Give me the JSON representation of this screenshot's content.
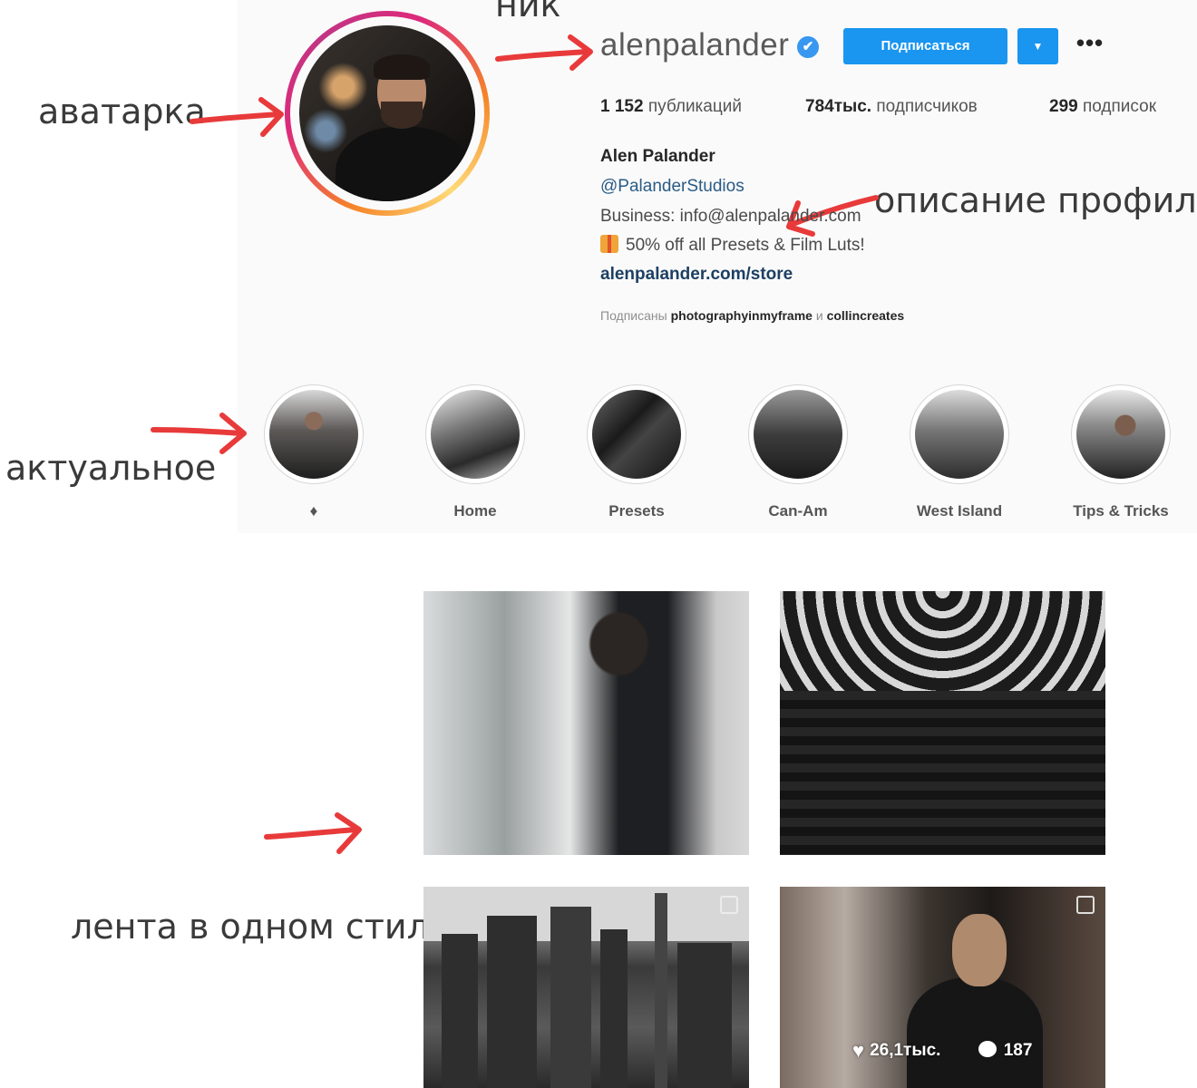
{
  "annotations": {
    "nick": "ник",
    "avatar": "аватарка",
    "description": "описание профиля",
    "highlights": "актуальное",
    "feed": "лента в одном стиле"
  },
  "profile": {
    "username": "alenpalander",
    "verified_icon": "✔",
    "follow_label": "Подписаться",
    "dropdown_icon": "▼",
    "more_icon": "•••",
    "stats": {
      "posts_value": "1 152",
      "posts_label": "публикаций",
      "followers_value": "784тыс.",
      "followers_label": "подписчиков",
      "following_value": "299",
      "following_label": "подписок"
    },
    "bio": {
      "name": "Alen Palander",
      "handle": "@PalanderStudios",
      "business": "Business: info@alenpalander.com",
      "promo": "50% off all Presets & Film Luts!",
      "link": "alenpalander.com/store"
    },
    "followed_by": {
      "prefix": "Подписаны",
      "user1": "photographyinmyframe",
      "conj": "и",
      "user2": "collincreates"
    }
  },
  "highlights": [
    {
      "label": "♦"
    },
    {
      "label": "Home"
    },
    {
      "label": "Presets"
    },
    {
      "label": "Can-Am"
    },
    {
      "label": "West Island"
    },
    {
      "label": "Tips & Tricks"
    }
  ],
  "feed": {
    "post4_likes": "26,1тыс.",
    "post4_comments": "187"
  },
  "colors": {
    "accent_blue": "#1a95f0",
    "annotation_arrow": "#e83a3a",
    "link_blue": "#1d3f63"
  }
}
